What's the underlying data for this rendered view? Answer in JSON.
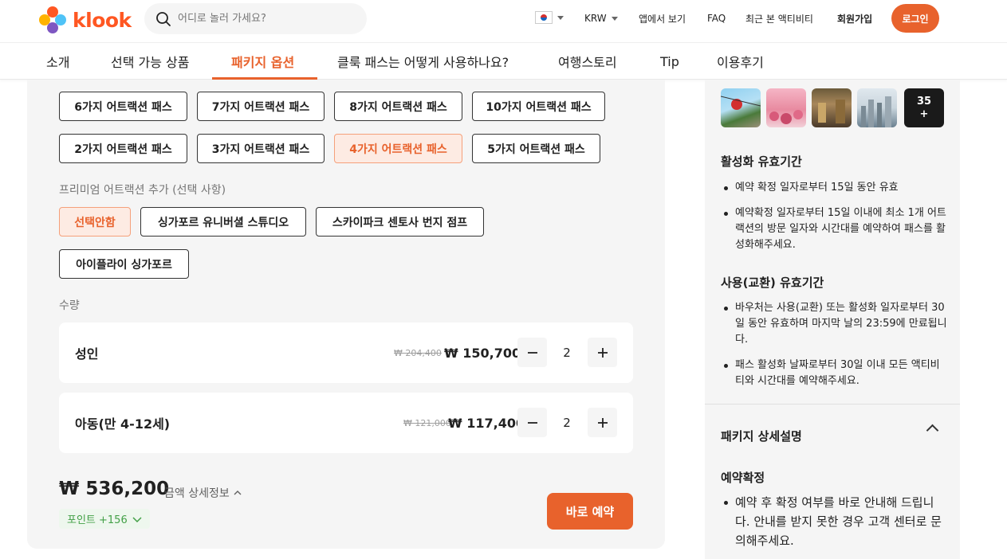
{
  "header": {
    "logo_text": "klook",
    "search_placeholder": "어디로 놀러 가세요?",
    "currency": "KRW",
    "app_link": "앱에서 보기",
    "faq": "FAQ",
    "recent": "최근 본 액티비티",
    "signup": "회원가입",
    "login": "로그인"
  },
  "tabs": [
    "소개",
    "선택 가능 상품",
    "패키지 옵션",
    "클룩 패스는 어떻게 사용하나요?",
    "여행스토리",
    "Tip",
    "이용후기"
  ],
  "active_tab": "패키지 옵션",
  "packages": {
    "row1": [
      "6가지 어트랙션 패스",
      "7가지 어트랙션 패스",
      "8가지 어트랙션 패스",
      "10가지 어트랙션 패스"
    ],
    "row2": [
      "2가지 어트랙션 패스",
      "3가지 어트랙션 패스",
      "4가지 어트랙션 패스",
      "5가지 어트랙션 패스"
    ],
    "selected": "4가지 어트랙션 패스"
  },
  "premium": {
    "label": "프리미엄 어트랙션 추가 (선택 사항)",
    "options": [
      "선택안함",
      "싱가포르 유니버셜 스튜디오",
      "스카이파크 센토사 번지 점프",
      "아이플라이 싱가포르"
    ],
    "selected": "선택안함"
  },
  "quantity": {
    "label": "수량",
    "rows": [
      {
        "name": "성인",
        "old_price": "₩ 204,400",
        "price": "₩ 150,700",
        "count": "2"
      },
      {
        "name": "아동(만 4-12세)",
        "old_price": "₩ 121,000",
        "price": "₩ 117,400",
        "count": "2"
      }
    ]
  },
  "summary": {
    "total": "₩ 536,200",
    "detail_link": "금액 상세정보",
    "points": "포인트 +156",
    "book_button": "바로 예약"
  },
  "gallery": {
    "more_count": "35",
    "more_plus": "+"
  },
  "right_panel": {
    "activation_title": "활성화 유효기간",
    "activation_items": [
      "예약 확정 일자로부터 15일 동안 유효",
      "예약확정 일자로부터 15일 이내에 최소 1개 어트랙션의 방문 일자와 시간대를 예약하여 패스를 활성화해주세요."
    ],
    "usage_title": "사용(교환) 유효기간",
    "usage_items": [
      "바우처는 사용(교환) 또는 활성화 일자로부터 30일 동안 유효하며 마지막 날의 23:59에 만료됩니다.",
      "패스 활성화 날짜로부터 30일 이내 모든 액티비티와 시간대를 예약해주세요."
    ],
    "package_detail_title": "패키지 상세설명",
    "confirm_title": "예약확정",
    "confirm_items": [
      "예약 후 확정 여부를 바로 안내해 드립니다. 안내를 받지 못한 경우 고객 센터로 문의해주세요."
    ]
  },
  "colors": {
    "accent": "#e8622c",
    "accent_light": "#fdebe3",
    "points_green": "#43a047"
  }
}
